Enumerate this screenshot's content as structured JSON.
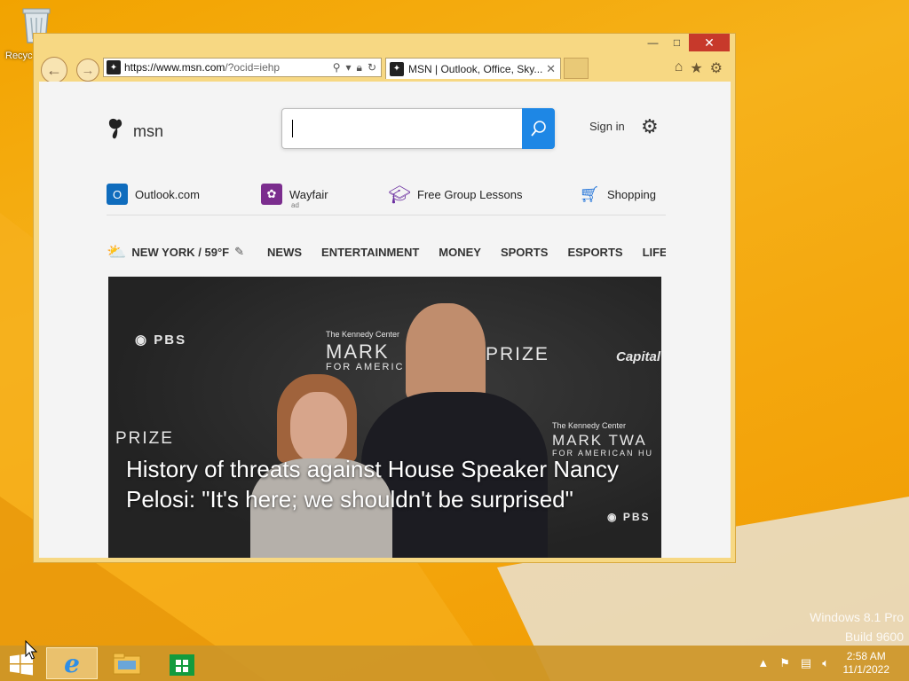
{
  "desktop": {
    "recycle_bin_label": "Recyc",
    "watermark": [
      "Windows 8.1 Pro",
      "Build 9600"
    ]
  },
  "browser": {
    "url_host": "https://www.msn.com",
    "url_path": "/?ocid=iehp",
    "tab_title": "MSN | Outlook, Office, Sky...",
    "icons": [
      "back-icon",
      "forward-icon",
      "search-icon",
      "lock-icon",
      "refresh-icon",
      "home-icon",
      "favorites-star-icon",
      "tools-gear-icon"
    ]
  },
  "msn": {
    "logo_text": "msn",
    "search_placeholder": "",
    "sign_in": "Sign in",
    "quick_links": [
      {
        "label": "Outlook.com",
        "sub": ""
      },
      {
        "label": "Wayfair",
        "sub": "ad"
      },
      {
        "label": "Free Group Lessons",
        "sub": ""
      },
      {
        "label": "Shopping",
        "sub": ""
      }
    ],
    "weather": "NEW YORK / 59°F",
    "nav": [
      "NEWS",
      "ENTERTAINMENT",
      "MONEY",
      "SPORTS",
      "ESPORTS",
      "LIFESTY"
    ],
    "hero": {
      "headline": "History of threats against House Speaker Nancy Pelosi: \"It's here; we shouldn't be surprised\"",
      "backdrop_text": {
        "pbs": "PBS",
        "mark_left_top": "The Kennedy Center",
        "mark_left": "MARK",
        "mark_left_sub": "FOR AMERIC",
        "prize_right": "PRIZE",
        "capital": "Capital",
        "prize_left": "PRIZE",
        "mark_right_top": "The Kennedy Center",
        "mark_right": "MARK TWA",
        "mark_right_sub": "FOR AMERICAN HU",
        "pbs2": "PBS"
      }
    }
  },
  "taskbar": {
    "time": "2:58 AM",
    "date": "11/1/2022",
    "apps": [
      "internet-explorer",
      "file-explorer",
      "store"
    ]
  }
}
